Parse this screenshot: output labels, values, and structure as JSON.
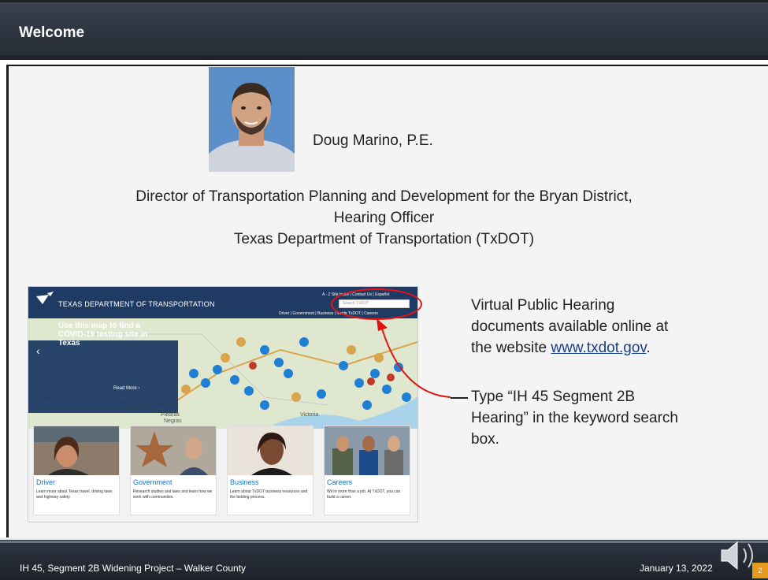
{
  "slide": {
    "title": "Welcome",
    "speaker_name": "Doug Marino, P.E.",
    "role_line1": "Director of Transportation Planning and Development for the Bryan District,",
    "role_line2": "Hearing Officer",
    "role_line3": "Texas Department of Transportation (TxDOT)",
    "info_line1": "Virtual Public Hearing",
    "info_line2": "documents available online at",
    "info_line3_prefix": "the website ",
    "info_link": "www.txdot.gov",
    "info_line3_suffix": ".",
    "search_line1": "Type “IH 45 Segment 2B",
    "search_line2": "Hearing” in the keyword search",
    "search_line3": "box.",
    "footer_left": "IH 45, Segment 2B Widening Project – Walker County",
    "footer_right": "January 13, 2022",
    "page_number": "2"
  },
  "website": {
    "header_title": "TEXAS DEPARTMENT OF TRANSPORTATION",
    "top_links": "A - Z Site Index | Contact Us | Español",
    "search_placeholder": "Search TxDOT",
    "nav": "Driver  |  Government  |  Business  |  Inside TxDOT  |  Careers",
    "panel_text": "Use this map to find a COVID-19 testing site in Texas",
    "panel_more": "Read More  ›",
    "map_label_1": "Piedras",
    "map_label_2": "Negras",
    "map_label_3": "Victoria",
    "cards": [
      {
        "title": "Driver",
        "text": "Learn more about Texas travel, driving laws and highway safety."
      },
      {
        "title": "Government",
        "text": "Research studies and laws and learn how we work with communities."
      },
      {
        "title": "Business",
        "text": "Learn about TxDOT business resources and the bidding process."
      },
      {
        "title": "Careers",
        "text": "We're more than a job. At TxDOT, you can build a career."
      }
    ]
  },
  "colors": {
    "accent_red": "#e11111",
    "header_navy": "#1f3b63",
    "page_badge": "#e39b1d"
  }
}
